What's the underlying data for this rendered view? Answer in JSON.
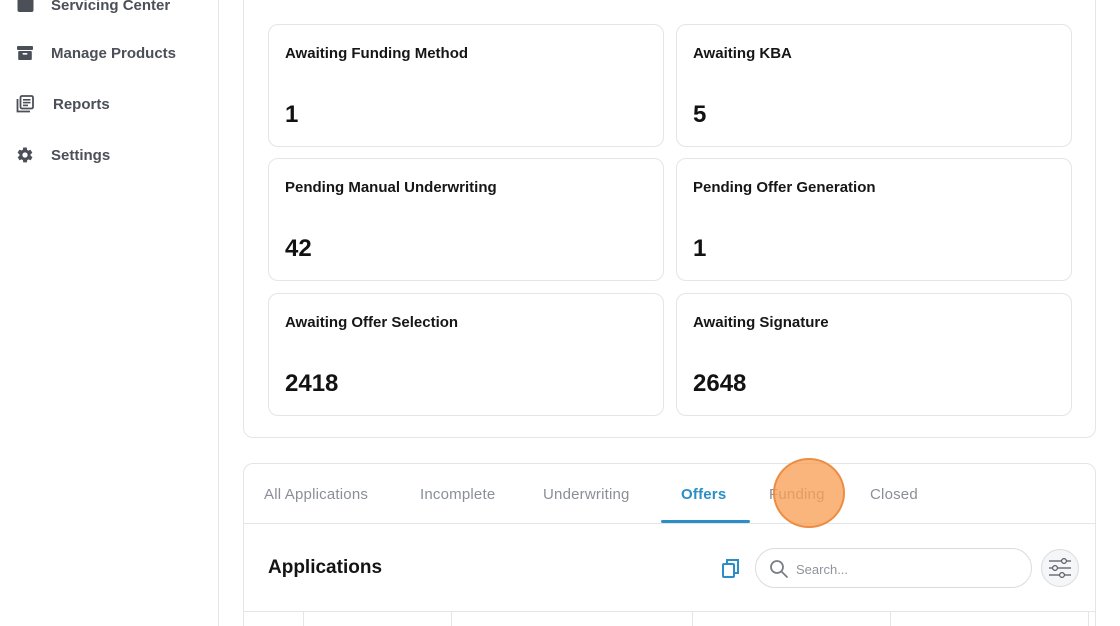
{
  "sidebar": {
    "items": [
      {
        "label": "Servicing Center",
        "icon": "folder-icon"
      },
      {
        "label": "Manage Products",
        "icon": "archive-box-icon"
      },
      {
        "label": "Reports",
        "icon": "document-stack-icon"
      },
      {
        "label": "Settings",
        "icon": "gear-icon"
      }
    ]
  },
  "stats": [
    {
      "label": "Awaiting Funding Method",
      "value": "1"
    },
    {
      "label": "Awaiting KBA",
      "value": "5"
    },
    {
      "label": "Pending Manual Underwriting",
      "value": "42"
    },
    {
      "label": "Pending Offer Generation",
      "value": "1"
    },
    {
      "label": "Awaiting Offer Selection",
      "value": "2418"
    },
    {
      "label": "Awaiting Signature",
      "value": "2648"
    }
  ],
  "tabs": [
    {
      "label": "All Applications"
    },
    {
      "label": "Incomplete"
    },
    {
      "label": "Underwriting"
    },
    {
      "label": "Offers",
      "active": true
    },
    {
      "label": "Funding"
    },
    {
      "label": "Closed"
    }
  ],
  "applications": {
    "title": "Applications",
    "search_placeholder": "Search..."
  },
  "colors": {
    "accent": "#2c8ec6",
    "click_marker": "#f7a056"
  }
}
